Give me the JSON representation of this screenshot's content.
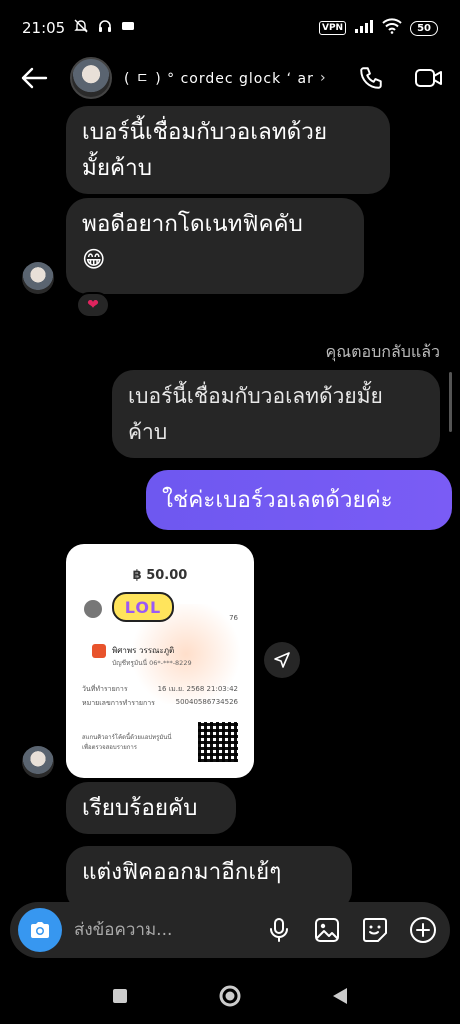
{
  "status_bar": {
    "time": "21:05",
    "left_icons": [
      "mute-icon",
      "headphones-icon",
      "sim-icon"
    ],
    "vpn": "VPN",
    "battery": "50"
  },
  "header": {
    "contact_name": "( ㄷ ) ° cordec glock ‘ arl...",
    "chevron": "›"
  },
  "messages": {
    "m1": "เบอร์นี้เชื่อมกับวอเลทด้วย\nมั้ยค้าบ",
    "m2_line1": "พอดีอยากโดเนทฟิคคับ",
    "m2_emoji": "😁",
    "reaction": "❤",
    "replied_label": "คุณตอบกลับแล้ว",
    "quoted": "เบอร์นี้เชื่อมกับวอเลทด้วยมั้ย\nค้าบ",
    "reply": "ใช่ค่ะเบอร์วอเลตด้วยค่ะ",
    "m3": "เรียบร้อยคับ",
    "m4": "แต่งฟิคออกมาอีกเย้ๆ"
  },
  "receipt": {
    "amount": "฿ 50.00",
    "sticker": "LOL",
    "id_fragment": "76",
    "payee_name": "พิศาพร วรรณะภูติ",
    "payee_account": "บัญชีทรูมันนี่ 06*-***-8229",
    "date_label": "วันที่ทำรายการ",
    "date_value": "16 เม.ย. 2568 21:03:42",
    "ref_label": "หมายเลขการทำรายการ",
    "ref_value": "50040586734526",
    "scan_note": "สแกนคิวอาร์โค้ดนี้ด้วยแอปทรูมันนี่\nเพื่อตรวจสอบรายการ"
  },
  "composer": {
    "placeholder": "ส่งข้อความ..."
  },
  "colors": {
    "accent": "#3797f0",
    "outgoing": "#7a5cf5",
    "bubble": "#262626"
  }
}
